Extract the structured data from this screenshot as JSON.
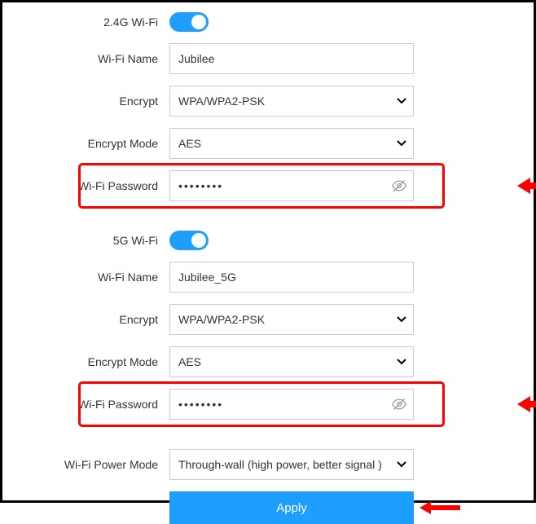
{
  "section24": {
    "title": "2.4G Wi-Fi",
    "toggle_on": true,
    "name_label": "Wi-Fi Name",
    "name_value": "Jubilee",
    "encrypt_label": "Encrypt",
    "encrypt_value": "WPA/WPA2-PSK",
    "mode_label": "Encrypt Mode",
    "mode_value": "AES",
    "pw_label": "Wi-Fi Password",
    "pw_value": "••••••••"
  },
  "section5g": {
    "title": "5G Wi-Fi",
    "toggle_on": true,
    "name_label": "Wi-Fi Name",
    "name_value": "Jubilee_5G",
    "encrypt_label": "Encrypt",
    "encrypt_value": "WPA/WPA2-PSK",
    "mode_label": "Encrypt Mode",
    "mode_value": "AES",
    "pw_label": "Wi-Fi Password",
    "pw_value": "••••••••"
  },
  "power": {
    "label": "Wi-Fi Power Mode",
    "value": "Through-wall (high power, better signal )"
  },
  "apply_label": "Apply"
}
